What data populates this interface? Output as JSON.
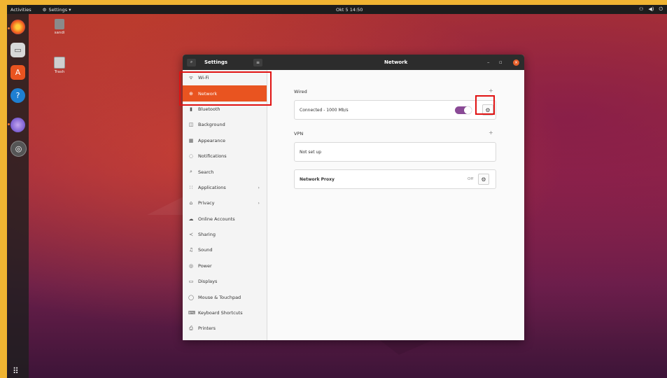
{
  "topbar": {
    "activities": "Activities",
    "app_menu": "Settings ▾",
    "clock": "Okt 5 14:50",
    "tray": [
      "⚇",
      "◀)",
      "⏻"
    ]
  },
  "desktop": {
    "icons": [
      {
        "label": "sandi"
      },
      {
        "label": "Trash"
      }
    ]
  },
  "window": {
    "sidebar_title": "Settings",
    "page_title": "Network",
    "sidebar": [
      {
        "icon": "wifi-icon",
        "glyph": "ᯤ",
        "label": "Wi-Fi",
        "active": false
      },
      {
        "icon": "network-icon",
        "glyph": "⊕",
        "label": "Network",
        "active": true
      },
      {
        "icon": "bluetooth-icon",
        "glyph": "▮",
        "label": "Bluetooth",
        "active": false
      },
      {
        "icon": "background-icon",
        "glyph": "◫",
        "label": "Background",
        "active": false
      },
      {
        "icon": "appearance-icon",
        "glyph": "▦",
        "label": "Appearance",
        "active": false
      },
      {
        "icon": "notifications-icon",
        "glyph": "◌",
        "label": "Notifications",
        "active": false
      },
      {
        "icon": "search-icon",
        "glyph": "⌕",
        "label": "Search",
        "active": false
      },
      {
        "icon": "applications-icon",
        "glyph": "∷",
        "label": "Applications",
        "active": false,
        "chevron": "›"
      },
      {
        "icon": "privacy-icon",
        "glyph": "⌂",
        "label": "Privacy",
        "active": false,
        "chevron": "›"
      },
      {
        "icon": "online-accounts-icon",
        "glyph": "☁",
        "label": "Online Accounts",
        "active": false
      },
      {
        "icon": "sharing-icon",
        "glyph": "≺",
        "label": "Sharing",
        "active": false
      },
      {
        "icon": "sound-icon",
        "glyph": "♫",
        "label": "Sound",
        "active": false
      },
      {
        "icon": "power-icon",
        "glyph": "◎",
        "label": "Power",
        "active": false
      },
      {
        "icon": "displays-icon",
        "glyph": "▭",
        "label": "Displays",
        "active": false
      },
      {
        "icon": "mouse-icon",
        "glyph": "◯",
        "label": "Mouse & Touchpad",
        "active": false
      },
      {
        "icon": "keyboard-icon",
        "glyph": "⌨",
        "label": "Keyboard Shortcuts",
        "active": false
      },
      {
        "icon": "printers-icon",
        "glyph": "⎙",
        "label": "Printers",
        "active": false
      }
    ],
    "wired": {
      "title": "Wired",
      "status": "Connected - 1000 Mb/s",
      "toggle_on": true
    },
    "vpn": {
      "title": "VPN",
      "status": "Not set up"
    },
    "proxy": {
      "label": "Network Proxy",
      "status": "Off"
    }
  },
  "colors": {
    "accent": "#e95420",
    "toggle": "#8a4a96",
    "highlight": "#e01212"
  }
}
